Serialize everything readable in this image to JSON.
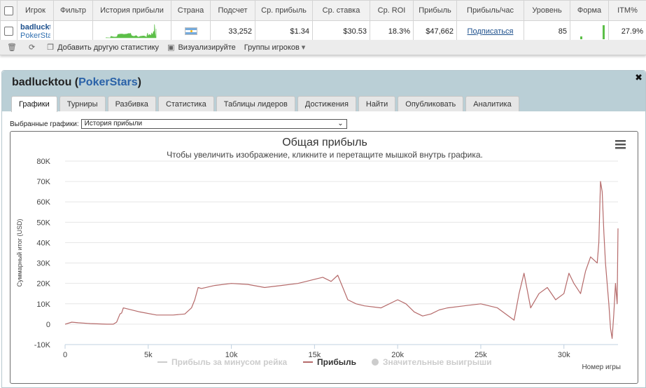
{
  "table": {
    "headers": [
      "Игрок",
      "Фильтр",
      "История прибыли",
      "Страна",
      "Подсчет",
      "Ср. прибыль",
      "Ср. ставка",
      "Ср. ROI",
      "Прибыль",
      "Прибыль/час",
      "Уровень",
      "Форма",
      "ITM%"
    ],
    "row": {
      "player": "badlucktou",
      "site": "PokerStars",
      "filter": "",
      "count": "33,252",
      "avg_profit": "$1.34",
      "avg_stake": "$30.53",
      "avg_roi": "18.3%",
      "profit": "$47,662",
      "profit_per_hour": "Подписаться",
      "level": "85",
      "itm": "27.9%"
    }
  },
  "toolbar": {
    "add_stats": "Добавить другую статистику",
    "visualize": "Визуализируйте",
    "player_groups": "Группы игроков"
  },
  "panel": {
    "player": "badlucktou",
    "site": "PokerStars",
    "tabs": [
      "Графики",
      "Турниры",
      "Разбивка",
      "Статистика",
      "Таблицы лидеров",
      "Достижения",
      "Найти",
      "Опубликовать",
      "Аналитика"
    ],
    "active_tab": 0,
    "select_label": "Выбранные графики:",
    "select_value": "История прибыли"
  },
  "colors": {
    "profit_line": "#b56a6a",
    "sparkline": "#5cbf48",
    "accent_link": "#1c4f8c"
  },
  "chart_data": {
    "type": "line",
    "title": "Общая прибыль",
    "subtitle": "Чтобы увеличить изображение, кликните и перетащите мышкой внутрь графика.",
    "ylabel": "Суммарный итог (USD)",
    "xlabel": "Номер игры",
    "ylim": [
      -10000,
      80000
    ],
    "xlim": [
      0,
      33252
    ],
    "yticks": [
      "80K",
      "70K",
      "60K",
      "50K",
      "40K",
      "30K",
      "20K",
      "10K",
      "0",
      "-10K"
    ],
    "xticks": [
      "0",
      "5k",
      "10k",
      "15k",
      "20k",
      "25k",
      "30k"
    ],
    "legend": [
      "Прибыль за минусом рейка",
      "Прибыль",
      "Значительные выигрыши"
    ],
    "grid": "horizontal",
    "series": [
      {
        "name": "Прибыль",
        "x": [
          0,
          400,
          800,
          1500,
          2500,
          2700,
          2900,
          3100,
          3200,
          3300,
          3400,
          3500,
          4500,
          5500,
          6500,
          7200,
          7600,
          7800,
          7900,
          8000,
          8200,
          9000,
          10000,
          11000,
          12000,
          13000,
          14000,
          14500,
          15000,
          15500,
          16000,
          16400,
          16700,
          17000,
          17500,
          18000,
          19000,
          20000,
          20500,
          21000,
          21500,
          22000,
          22500,
          23000,
          24000,
          25000,
          26000,
          27000,
          27300,
          27600,
          28000,
          28500,
          29000,
          29500,
          30000,
          30300,
          30600,
          31000,
          31300,
          31600,
          32000,
          32100,
          32200,
          32300,
          32400,
          32500,
          32600,
          32700,
          32800,
          32900,
          33000,
          33100,
          33200,
          33252
        ],
        "y": [
          0,
          1000,
          700,
          300,
          0,
          0,
          0,
          1000,
          3000,
          5000,
          5500,
          8000,
          6000,
          4500,
          4500,
          5000,
          8000,
          12000,
          15000,
          18000,
          17500,
          19000,
          20000,
          19500,
          18000,
          19000,
          20000,
          21000,
          22000,
          23000,
          21000,
          24000,
          18000,
          12000,
          10000,
          9000,
          8000,
          12000,
          10000,
          6000,
          4000,
          5000,
          7000,
          8000,
          9000,
          10000,
          8000,
          2000,
          15000,
          25000,
          8000,
          15000,
          18000,
          12000,
          15000,
          25000,
          20000,
          15000,
          26000,
          33000,
          30000,
          40000,
          70000,
          65000,
          45000,
          30000,
          20000,
          10000,
          -2000,
          -7000,
          5000,
          20000,
          10000,
          47000
        ]
      }
    ]
  }
}
